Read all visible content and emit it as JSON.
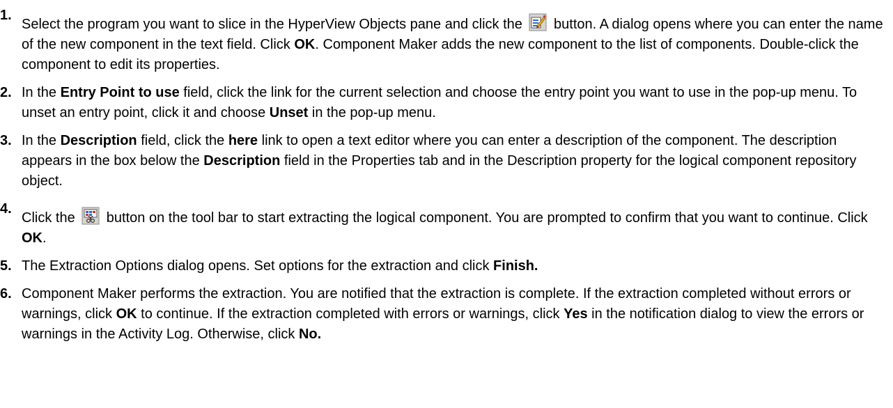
{
  "steps": [
    {
      "number": "1.",
      "raised": true,
      "segments": [
        {
          "text": "Select the program you want to slice in the HyperView Objects pane and click the ",
          "bold": false
        },
        {
          "icon": "new-component-icon"
        },
        {
          "text": " button. A dialog opens where you can enter the name of the new component in the text field. Click ",
          "bold": false
        },
        {
          "text": "OK",
          "bold": true
        },
        {
          "text": ". Component Maker adds the new component to the list of components. Double-click the component to edit its properties.",
          "bold": false
        }
      ]
    },
    {
      "number": "2.",
      "raised": false,
      "segments": [
        {
          "text": "In the ",
          "bold": false
        },
        {
          "text": "Entry Point to use",
          "bold": true
        },
        {
          "text": " field, click the link for the current selection and choose the entry point you want to use in the pop-up menu. To unset an entry point, click it and choose ",
          "bold": false
        },
        {
          "text": "Unset",
          "bold": true
        },
        {
          "text": " in the pop-up menu.",
          "bold": false
        }
      ]
    },
    {
      "number": "3.",
      "raised": false,
      "segments": [
        {
          "text": "In the ",
          "bold": false
        },
        {
          "text": "Description",
          "bold": true
        },
        {
          "text": " field, click the ",
          "bold": false
        },
        {
          "text": "here",
          "bold": true
        },
        {
          "text": " link to open a text editor where you can enter a description of the component. The description appears in the box below the ",
          "bold": false
        },
        {
          "text": "Description",
          "bold": true
        },
        {
          "text": " field in the Properties tab and in the Description property for the logical component repository object.",
          "bold": false
        }
      ]
    },
    {
      "number": "4.",
      "raised": true,
      "segments": [
        {
          "text": "Click the ",
          "bold": false
        },
        {
          "icon": "extract-component-icon"
        },
        {
          "text": " button on the tool bar to start extracting the logical component. You are prompted to confirm that you want to continue. Click ",
          "bold": false
        },
        {
          "text": "OK",
          "bold": true
        },
        {
          "text": ".",
          "bold": false
        }
      ]
    },
    {
      "number": "5.",
      "raised": false,
      "segments": [
        {
          "text": "The Extraction Options dialog opens. Set options for the extraction and click ",
          "bold": false
        },
        {
          "text": "Finish.",
          "bold": true
        }
      ]
    },
    {
      "number": "6.",
      "raised": false,
      "segments": [
        {
          "text": "Component Maker performs the extraction. You are notified that the extraction is complete. If the extraction completed without errors or warnings, click ",
          "bold": false
        },
        {
          "text": "OK",
          "bold": true
        },
        {
          "text": " to continue. If the extraction completed with errors or warnings, click ",
          "bold": false
        },
        {
          "text": "Yes",
          "bold": true
        },
        {
          "text": " in the notification dialog to view the errors or warnings in the Activity Log. Otherwise, click ",
          "bold": false
        },
        {
          "text": "No.",
          "bold": true
        }
      ]
    }
  ]
}
